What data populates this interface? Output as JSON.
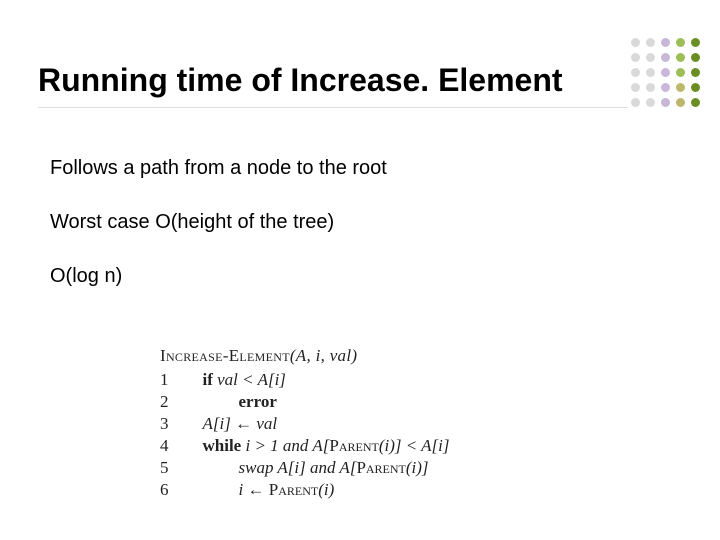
{
  "title": "Running time of Increase. Element",
  "bullets": {
    "b1": "Follows a path from a node to the root",
    "b2": "Worst case O(height of the tree)",
    "b3": "O(log n)"
  },
  "code": {
    "header_sc": "Increase-Element",
    "header_args": "(A, i, val)",
    "num1": "1",
    "num2": "2",
    "num3": "3",
    "num4": "4",
    "num5": "5",
    "num6": "6",
    "l1_kw": "if",
    "l1_rest": " val < A[i]",
    "l2": "error",
    "l3": "A[i] ← val",
    "l4_kw": "while",
    "l4_mid": " i > 1 and A[",
    "l4_sc": "Parent",
    "l4_end": "(i)] < A[i]",
    "l5_a": "swap A[i] and A[",
    "l5_sc": "Parent",
    "l5_b": "(i)]",
    "l6_a": "i ← ",
    "l6_sc": "Parent",
    "l6_b": "(i)"
  }
}
